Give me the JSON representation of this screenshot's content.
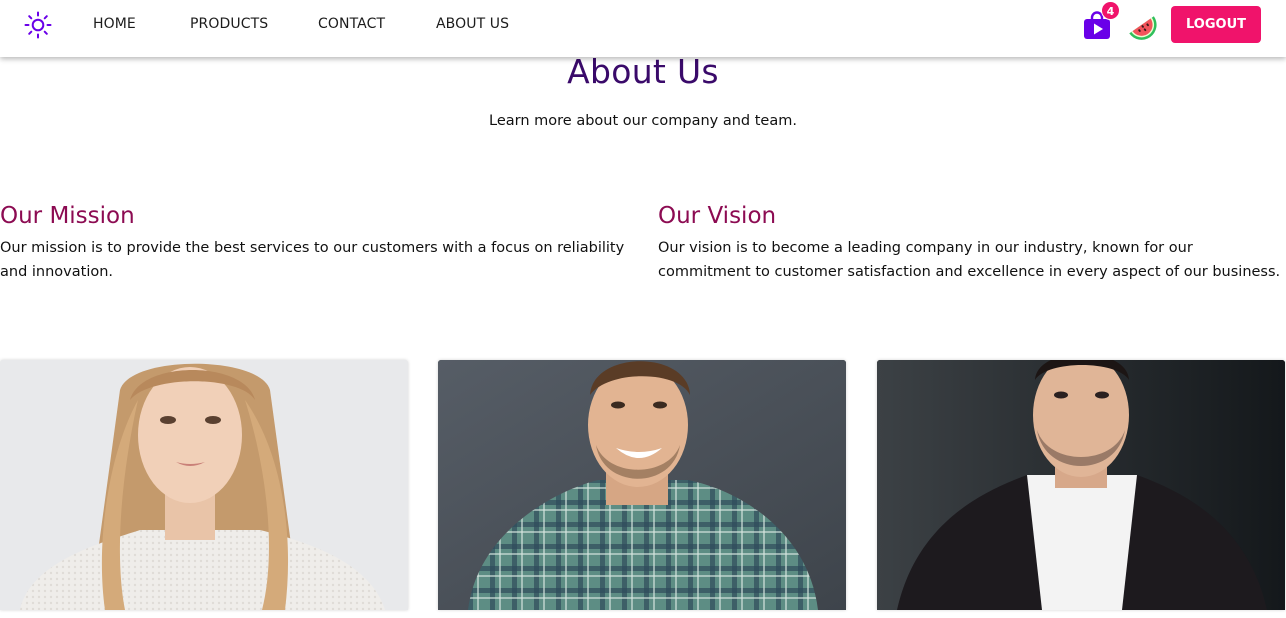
{
  "nav": {
    "items": [
      {
        "label": "HOME"
      },
      {
        "label": "PRODUCTS"
      },
      {
        "label": "CONTACT"
      },
      {
        "label": "ABOUT US"
      }
    ],
    "cart_count": "4",
    "logout_label": "LOGOUT",
    "icons": {
      "theme_toggle": "sun-icon",
      "cart": "shopping-bag-play-icon",
      "avatar": "watermelon-avatar-icon"
    },
    "colors": {
      "accent": "#f0136b",
      "brand_purple": "#6a00e8"
    }
  },
  "header": {
    "title": "About Us",
    "subtitle": "Learn more about our company and team."
  },
  "mission": {
    "title": "Our Mission",
    "text": "Our mission is to provide the best services to our customers with a focus on reliability and innovation."
  },
  "vision": {
    "title": "Our Vision",
    "text": "Our vision is to become a leading company in our industry, known for our commitment to customer satisfaction and excellence in every aspect of our business."
  },
  "team": [
    {
      "photo": "woman-portrait-photo"
    },
    {
      "photo": "smiling-man-portrait-photo"
    },
    {
      "photo": "man-in-suit-portrait-photo"
    }
  ],
  "colors": {
    "title": "#3a0a6a",
    "section_heading": "#8c0b52"
  }
}
